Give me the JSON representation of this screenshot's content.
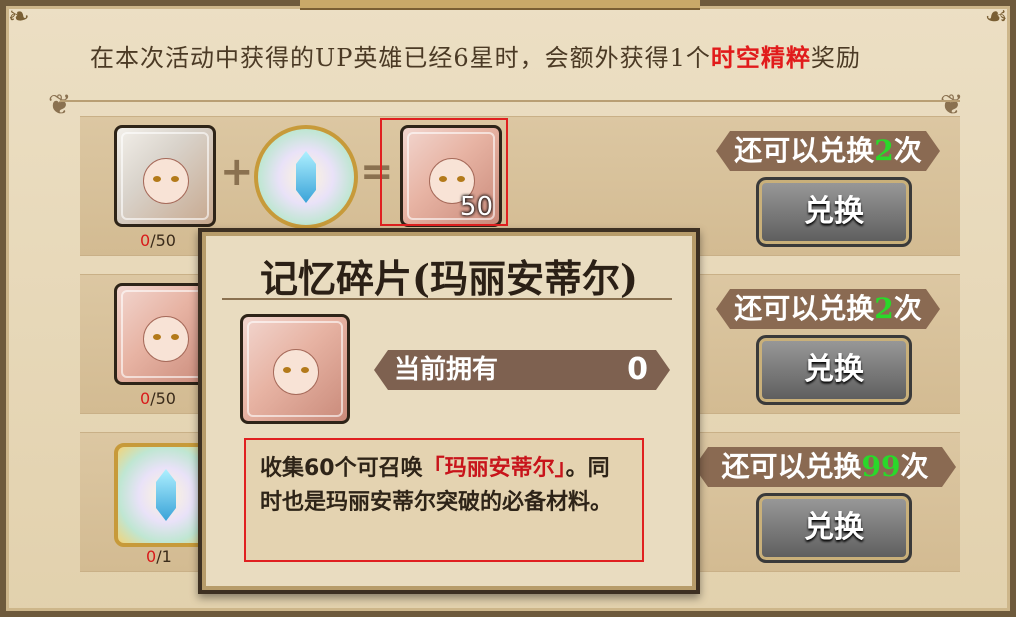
{
  "notice": {
    "prefix": "在本次活动中获得的UP英雄已经6星时，会额外获得1个",
    "highlight": "时空精粹",
    "suffix": "奖励"
  },
  "rows": [
    {
      "input1_count": "0",
      "input1_total": "/50",
      "output_badge": "50",
      "remaining_prefix": "还可以兑换",
      "remaining_num": "2",
      "remaining_suffix": "次",
      "button": "兑换"
    },
    {
      "input1_count": "0",
      "input1_total": "/50",
      "remaining_prefix": "还可以兑换",
      "remaining_num": "2",
      "remaining_suffix": "次",
      "button": "兑换"
    },
    {
      "input1_count": "0",
      "input1_total": "/1",
      "remaining_prefix": "还可以兑换",
      "remaining_num": "99",
      "remaining_suffix": "次",
      "button": "兑换"
    }
  ],
  "operators": {
    "plus": "+",
    "equals": "="
  },
  "tooltip": {
    "title": "记忆碎片(玛丽安蒂尔)",
    "own_label": "当前拥有",
    "own_value": "0",
    "desc_before": "收集60个可召唤",
    "desc_name": "「玛丽安蒂尔」",
    "desc_after": "。同时也是玛丽安蒂尔突破的必备材料。"
  },
  "colors": {
    "accent_red": "#e11b1b",
    "remaining_green": "#2ad82a",
    "panel_bg": "#e6d7b8"
  },
  "icons": {
    "gem": "crystal-gem-icon",
    "corner": "ornament-icon"
  }
}
